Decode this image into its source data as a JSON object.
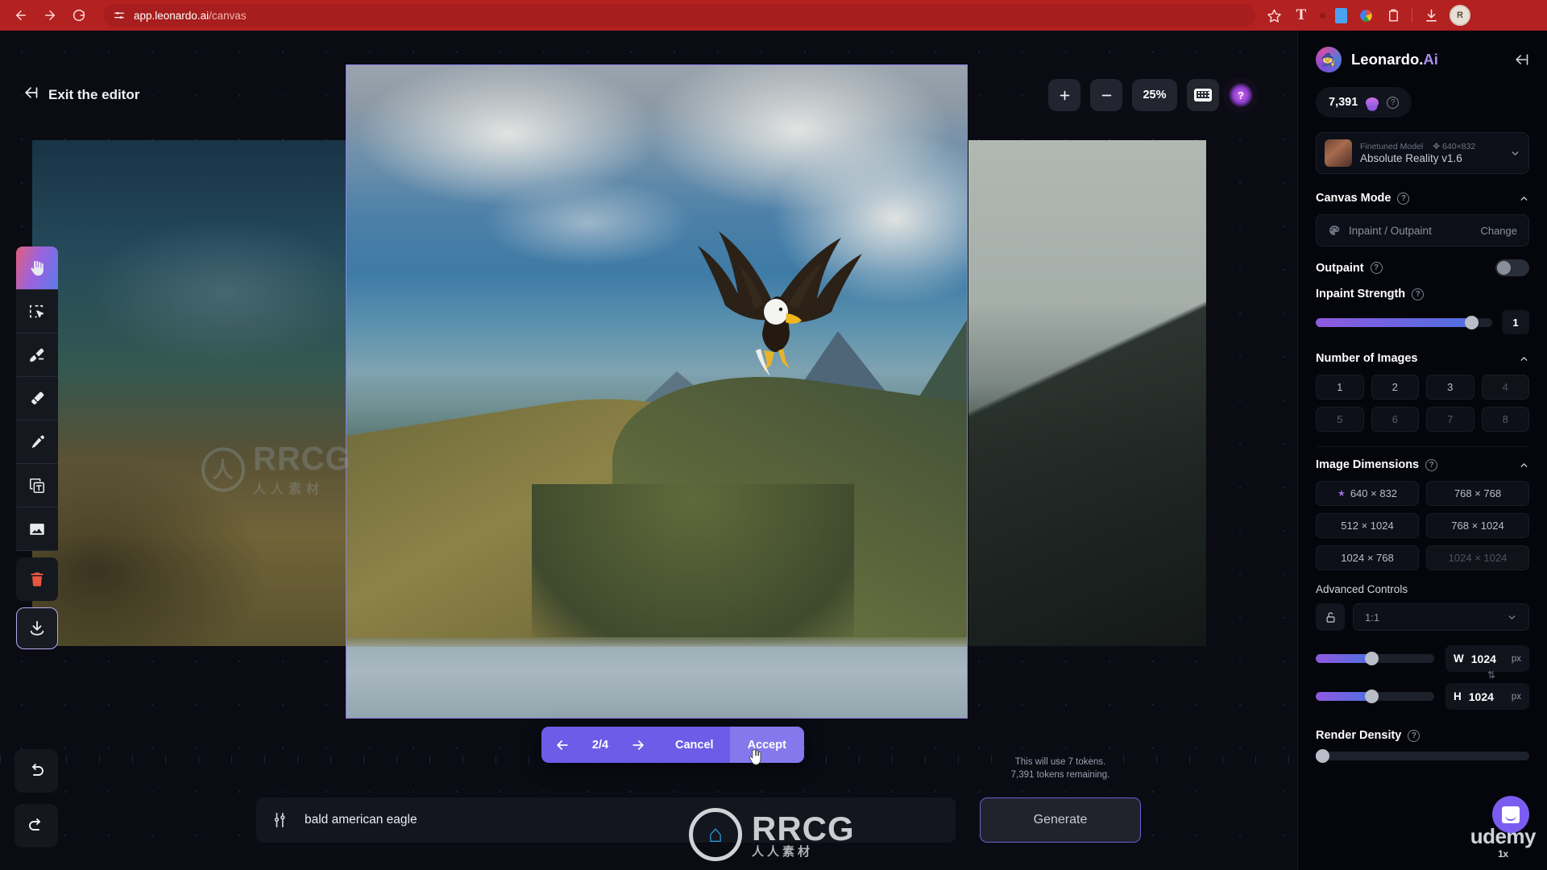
{
  "browser": {
    "url_display": "app.leonardo.ai",
    "url_path": "/canvas",
    "back_icon": "back-arrow-icon",
    "forward_icon": "forward-arrow-icon",
    "reload_icon": "reload-icon",
    "site_settings_icon": "site-settings-icon",
    "bookmark_icon": "star-icon",
    "toolbar_icons": [
      "translate-icon",
      "extension-dot-icon",
      "blue-extension-icon",
      "color-extension-icon",
      "clipboard-icon",
      "download-icon"
    ],
    "profile_initial": "R",
    "watermark": "RRCG.cn",
    "accent_color": "#b32121"
  },
  "editor": {
    "exit_label": "Exit the editor",
    "zoom": {
      "zoom_in_icon": "plus-icon",
      "zoom_out_icon": "minus-icon",
      "level": "25%",
      "keyboard_shortcuts_icon": "keyboard-icon",
      "help_label": "?"
    },
    "tools": [
      {
        "name": "hand-tool",
        "icon": "hand-icon",
        "active": true
      },
      {
        "name": "select-tool",
        "icon": "marquee-select-icon",
        "active": false
      },
      {
        "name": "brush-tool",
        "icon": "paint-brush-icon",
        "active": false
      },
      {
        "name": "eraser-tool",
        "icon": "eraser-icon",
        "active": false
      },
      {
        "name": "pencil-tool",
        "icon": "pencil-icon",
        "active": false
      },
      {
        "name": "text-tool",
        "icon": "text-box-icon",
        "active": false
      },
      {
        "name": "image-tool",
        "icon": "image-icon",
        "active": false
      },
      {
        "name": "delete-tool",
        "icon": "trash-icon",
        "active": false
      },
      {
        "name": "download-tool",
        "icon": "download-icon",
        "active": false
      }
    ],
    "history": {
      "undo_icon": "undo-arrow-icon",
      "redo_icon": "redo-arrow-icon"
    },
    "accept_bar": {
      "prev_icon": "left-arrow-icon",
      "counter": "2/4",
      "next_icon": "right-arrow-icon",
      "cancel_label": "Cancel",
      "accept_label": "Accept"
    },
    "prompt": {
      "settings_icon": "sliders-icon",
      "value": "bald american eagle",
      "placeholder": "bald american eagle"
    },
    "generate": {
      "token_line_1": "This will use 7 tokens.",
      "token_line_2": "7,391 tokens remaining.",
      "label": "Generate"
    },
    "canvas_watermark": {
      "text": "RRCG",
      "subtext": "人人素材"
    }
  },
  "panel": {
    "brand": {
      "name_main": "Leonardo.",
      "name_accent": "Ai",
      "logo_icon": "leonardo-avatar-icon",
      "collapse_icon": "collapse-panel-icon"
    },
    "tokens": {
      "amount": "7,391",
      "coin_icon": "token-coin-icon",
      "help_icon": "help-icon"
    },
    "model": {
      "label": "Finetuned Model",
      "dimensions": "640×832",
      "dimensions_icon": "move-icon",
      "name": "Absolute Reality v1.6",
      "chevron_icon": "chevron-down-icon"
    },
    "canvas_mode": {
      "title": "Canvas Mode",
      "help_icon": "help-icon",
      "caret_icon": "chevron-up-icon",
      "mode_icon": "palette-icon",
      "mode_label": "Inpaint / Outpaint",
      "change_label": "Change"
    },
    "outpaint": {
      "title": "Outpaint",
      "help_icon": "help-icon",
      "enabled": false
    },
    "inpaint_strength": {
      "title": "Inpaint Strength",
      "help_icon": "help-icon",
      "value": "1",
      "percent": 88
    },
    "number_of_images": {
      "title": "Number of Images",
      "caret_icon": "chevron-up-icon",
      "options": [
        {
          "label": "1",
          "disabled": false
        },
        {
          "label": "2",
          "disabled": false
        },
        {
          "label": "3",
          "disabled": false
        },
        {
          "label": "4",
          "disabled": true
        },
        {
          "label": "5",
          "disabled": false
        },
        {
          "label": "6",
          "disabled": false
        },
        {
          "label": "7",
          "disabled": false
        },
        {
          "label": "8",
          "disabled": false
        }
      ]
    },
    "image_dimensions": {
      "title": "Image Dimensions",
      "help_icon": "help-icon",
      "caret_icon": "chevron-up-icon",
      "presets": [
        {
          "label": "640 × 832",
          "starred": true,
          "disabled": false
        },
        {
          "label": "768 × 768",
          "starred": false,
          "disabled": false
        },
        {
          "label": "512 × 1024",
          "starred": false,
          "disabled": false
        },
        {
          "label": "768 × 1024",
          "starred": false,
          "disabled": false
        },
        {
          "label": "1024 × 768",
          "starred": false,
          "disabled": false
        },
        {
          "label": "1024 × 1024",
          "starred": false,
          "disabled": true
        }
      ]
    },
    "advanced_controls": {
      "title": "Advanced Controls",
      "lock_icon": "unlock-icon",
      "ratio_value": "1:1",
      "ratio_chevron_icon": "chevron-down-icon",
      "width": {
        "key": "W",
        "value": "1024",
        "unit": "px",
        "percent": 47
      },
      "height": {
        "key": "H",
        "value": "1024",
        "unit": "px",
        "percent": 47
      },
      "swap_icon": "swap-wh-icon"
    },
    "render_density": {
      "title": "Render Density",
      "help_icon": "help-icon",
      "percent": 3
    },
    "support": {
      "intercom_icon": "chat-bubble-icon",
      "watermark": "udemy",
      "watermark_sub": "1x"
    }
  }
}
